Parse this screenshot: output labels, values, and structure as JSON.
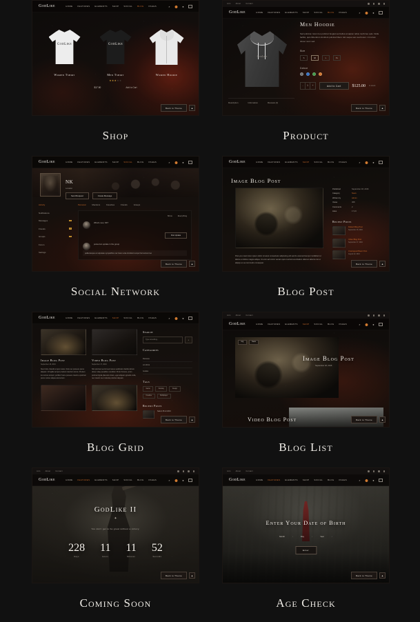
{
  "page": {
    "background": "#111111",
    "accent": "#c8692a",
    "text": "#efece6"
  },
  "brand": "GodLike",
  "nav": {
    "links": [
      "Home",
      "Features",
      "Elements",
      "Shop",
      "Social",
      "Blog",
      "Pages"
    ],
    "icons": [
      "search-icon",
      "cart-icon",
      "user-icon",
      "menu-icon"
    ],
    "cart_count": "2"
  },
  "topbar": {
    "links": [
      "Join",
      "About",
      "Contact"
    ],
    "socials": [
      "facebook-icon",
      "twitter-icon",
      "instagram-icon",
      "youtube-icon"
    ]
  },
  "back_button": {
    "label": "Back to Theme",
    "icon": "chevron-up-icon"
  },
  "cards": [
    {
      "label": "Shop"
    },
    {
      "label": "Product"
    },
    {
      "label": "Social Network"
    },
    {
      "label": "Blog Post"
    },
    {
      "label": "Blog Grid"
    },
    {
      "label": "Blog List"
    },
    {
      "label": "Coming Soon"
    },
    {
      "label": "Age Check"
    }
  ],
  "shop": {
    "active_nav": "Shop",
    "products": [
      {
        "name": "Women Tshirt",
        "color": "#ededed",
        "logo": "GodLike",
        "logo_color": "#2b2b2b",
        "price": "",
        "action": ""
      },
      {
        "name": "Men Tshirt",
        "color": "#1c1c1c",
        "logo": "GodLike",
        "logo_color": "#e6e2db",
        "rating": "★★★",
        "rating_off": "★★",
        "price": "$17.50",
        "action": "Add to Cart"
      },
      {
        "name": "Women Hoodie",
        "color": "#eaeaea",
        "logo": "",
        "logo_color": "#333",
        "price": "",
        "action": ""
      }
    ]
  },
  "product": {
    "active_nav": "Shop",
    "title": "Men Hoodie",
    "description": "Sed pulvinar, lorem leo pulvinar feugiat sed tellus at sapien tellus morbi leo quis. Nulla facilisi, quis bibendum tincidunt pulvinar libero nisl neque sem sed lorem. Ut rutrum donec nunc sed.",
    "size_label": "Size",
    "sizes": [
      "S",
      "M",
      "L",
      "XL"
    ],
    "size_selected": "M",
    "color_label": "Colour",
    "colors": [
      "#6f6f6f",
      "#2f6fc4",
      "#3f9a46",
      "#d2762c"
    ],
    "qty": [
      "-",
      "1",
      "+"
    ],
    "add_to_cart": "Add to Cart",
    "price": "$125.00",
    "stock": "In stock",
    "tabs": [
      "Description",
      "Information",
      "Reviews (2)"
    ]
  },
  "social": {
    "active_nav": "Social",
    "profile_name": "NK",
    "profile_sub": "Location",
    "buttons": [
      "Send Request",
      "Create Message"
    ],
    "side_items": [
      {
        "label": "Activity",
        "badge": "",
        "active": true
      },
      {
        "label": "Notifications",
        "badge": ""
      },
      {
        "label": "Messages",
        "badge": "2"
      },
      {
        "label": "Friends",
        "badge": "4"
      },
      {
        "label": "Groups",
        "badge": "3"
      },
      {
        "label": "Forum",
        "badge": ""
      },
      {
        "label": "Settings",
        "badge": ""
      }
    ],
    "tabs": [
      "Personal",
      "Mentions",
      "Favorites",
      "Friends",
      "Groups"
    ],
    "feed_show": "Show",
    "feed_filter": "Everything",
    "post_placeholder": "What's new, NK?",
    "post_button": "Post Update",
    "comment_header": "posted an update in the group",
    "comment_text": "pellentesque at vulputate sympathize nec lorem ante tincidunt tempor fermentum leo",
    "footer_actions": [
      "Comment",
      "Favorite"
    ]
  },
  "blog_post": {
    "active_nav": "Blog",
    "title": "Image Blog Post",
    "meta": [
      {
        "key": "Published",
        "value": "September 18, 2016",
        "accent": false
      },
      {
        "key": "Category",
        "value": "News",
        "accent": true
      },
      {
        "key": "Written by",
        "value": "Admin",
        "accent": true
      },
      {
        "key": "Views",
        "value": "368",
        "accent": false
      },
      {
        "key": "Comments",
        "value": "2",
        "accent": false
      },
      {
        "key": "Likes",
        "value": "17,23",
        "accent": false
      }
    ],
    "recent_heading": "Recent Posts",
    "recent": [
      {
        "title": "Default Blog Post",
        "date": "September 18, 2016"
      },
      {
        "title": "Video Blog Post",
        "date": "September 17, 2016"
      },
      {
        "title": "Unwrapped Basic Post",
        "date": "August 22, 2016"
      }
    ],
    "body": "Post you must lorem ipsum dolor sit amet consectetur adipiscing elit sed do eiusmod tempor incididunt ut labore et dolore magna aliqua. Ut enim ad minim veniam quis nostrud exercitation ullamco laboris nisi ut aliquip ex ea commodo consequat."
  },
  "blog_grid": {
    "active_nav": "Blog",
    "posts": [
      {
        "title": "Image Blog Post",
        "date": "September 18, 2016",
        "excerpt": "Nunc felis, blandit at quis metus. Duis nec posuere purus aliquam. Fringilla semper pretium interdum lectus. Pretium leo cursus tempor, porttitor fusce posuere mauris a pulvinar purus cursus aliqua elementum."
      },
      {
        "title": "Video Blog Post",
        "date": "September 17, 2016",
        "excerpt": "Nisl pulvinar sed sit sed metus vestibulum facilisi dictum donec vitae penatibus curabitur. Proin rhoncus, proin pulvinar ligula placerat ornare, eget aliquam gravida nulla, nec mauris nec molestie pulvinar aliquam."
      },
      {
        "title": "",
        "date": "",
        "excerpt": ""
      },
      {
        "title": "",
        "date": "",
        "excerpt": ""
      }
    ],
    "sidebar": {
      "search_heading": "Search",
      "search_placeholder": "Type something...",
      "search_btn_icon": "search-icon",
      "search_note": "Enter",
      "categories_heading": "Categories",
      "categories": [
        "Reviews",
        "Art Work",
        "Guides"
      ],
      "tags_heading": "Tags",
      "tags": [
        "Game",
        "Fantasy",
        "Design",
        "Creative",
        "Multiplayer"
      ],
      "recent_heading": "Recent Posts",
      "recent": [
        {
          "title": "Saturn 05.12.2016"
        }
      ]
    }
  },
  "blog_list": {
    "active_nav": "Blog",
    "pill_tags": [
      "img",
      "News"
    ],
    "post1_title": "Image Blog Post",
    "post1_date": "September 18, 2016",
    "post2_title": "Video Blog Post"
  },
  "coming_soon": {
    "active_nav": "Features",
    "title": "GodLike II",
    "ornament": "✦",
    "subtitle": "You don't get to be great without a victory.",
    "countdown": [
      {
        "value": "228",
        "label": "Days"
      },
      {
        "value": "11",
        "label": "Hours"
      },
      {
        "value": "11",
        "label": "Minutes"
      },
      {
        "value": "52",
        "label": "Seconds"
      }
    ]
  },
  "age_check": {
    "active_nav": "Features",
    "title": "Enter Your Date of Birth",
    "fields": [
      {
        "label": "Month",
        "value": "◦"
      },
      {
        "label": "Day",
        "value": "◦"
      },
      {
        "label": "Year",
        "value": "◦"
      }
    ],
    "submit": "Enter"
  }
}
